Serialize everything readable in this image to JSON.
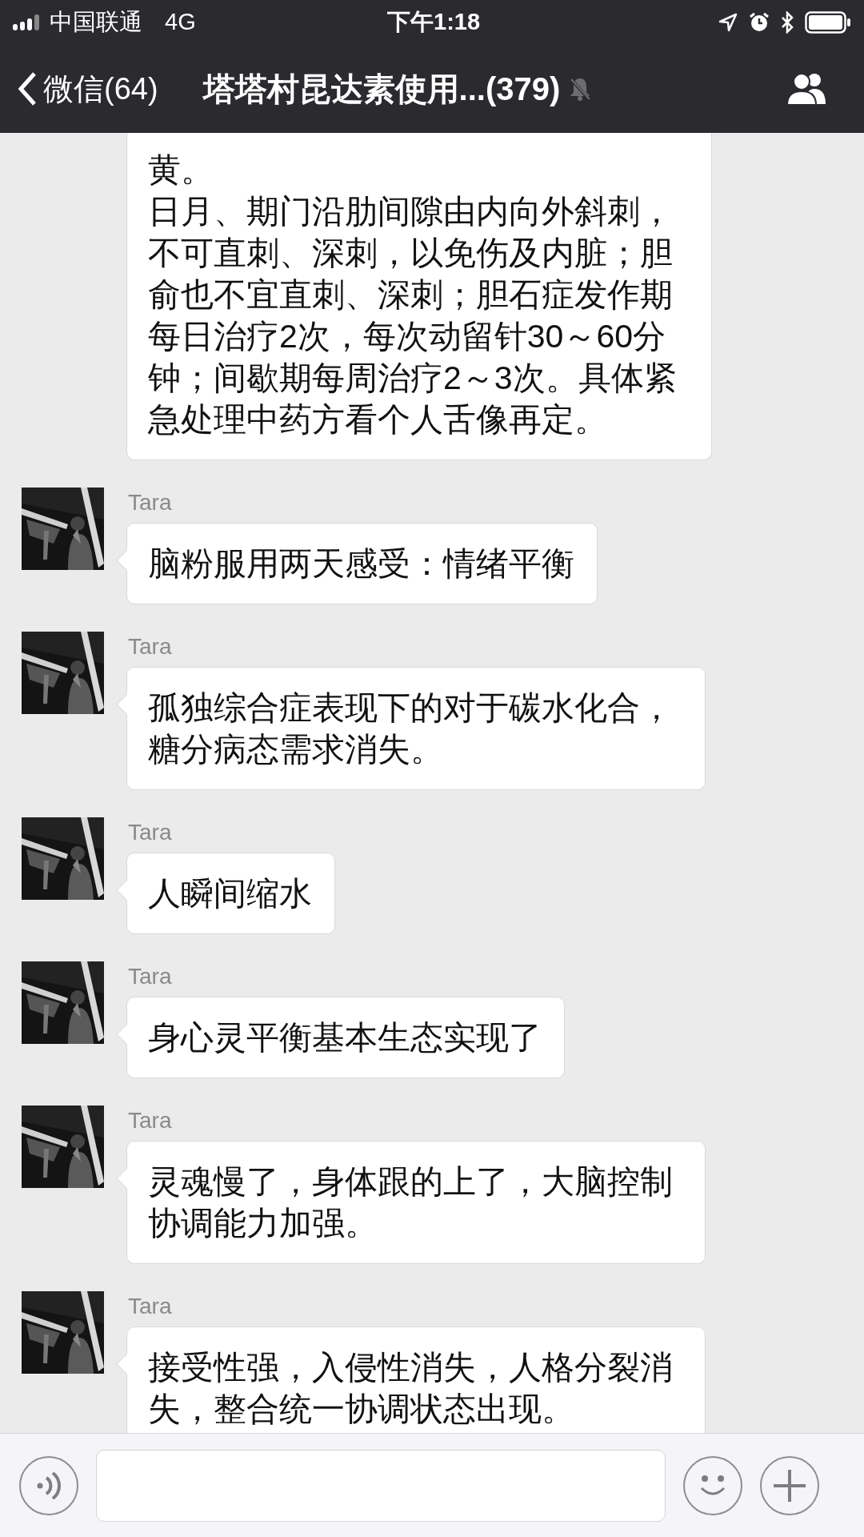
{
  "status_bar": {
    "carrier": "中国联通",
    "network": "4G",
    "time": "下午1:18"
  },
  "nav_bar": {
    "back_label": "微信(64)",
    "title": "塔塔村昆达素使用...(379)",
    "muted": true
  },
  "messages": [
    {
      "kind": "continued",
      "text": "黄。",
      "text_2": "日月、期门沿肋间隙由内向外斜刺，不可直刺、深刺，以免伤及内脏；胆俞也不宜直刺、深刺；胆石症发作期每日治疗2次，每次动留针30～60分钟；间歇期每周治疗2～3次。具体紧急处理中药方看个人舌像再定。"
    },
    {
      "kind": "received",
      "sender": "Tara",
      "text": "脑粉服用两天感受：情绪平衡"
    },
    {
      "kind": "received",
      "sender": "Tara",
      "text": "孤独综合症表现下的对于碳水化合，糖分病态需求消失。"
    },
    {
      "kind": "received",
      "sender": "Tara",
      "text": "人瞬间缩水"
    },
    {
      "kind": "received",
      "sender": "Tara",
      "text": "身心灵平衡基本生态实现了"
    },
    {
      "kind": "received",
      "sender": "Tara",
      "text": "灵魂慢了，身体跟的上了，大脑控制协调能力加强。"
    },
    {
      "kind": "received",
      "sender": "Tara",
      "text": "接受性强，入侵性消失，人格分裂消失，整合统一协调状态出现。"
    }
  ]
}
